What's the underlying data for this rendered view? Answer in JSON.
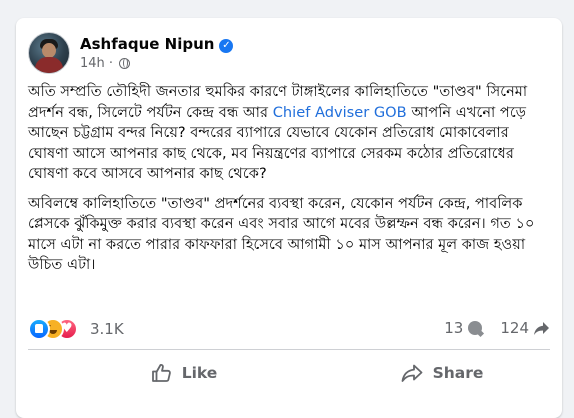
{
  "post": {
    "author": "Ashfaque Nipun",
    "verified_icon": "verified-badge-icon",
    "time": "14h",
    "separator": "·",
    "audience_icon": "globe-icon"
  },
  "content": {
    "p1_before_link": "অতি সম্প্রতি তৌহিদী জনতার হুমকির কারণে টাঙ্গাইলের কালিহাতিতে \"তাণ্ডব\" সিনেমা প্রদর্শন বন্ধ, সিলেটে পর্যটন কেন্দ্র বন্ধ আর ",
    "p1_link": "Chief Adviser GOB",
    "p1_after_link": " আপনি এখনো পড়ে আছেন চট্টগ্রাম বন্দর নিয়ে? বন্দরের ব্যাপারে যেভাবে যেকোন প্রতিরোধ মোকাবেলার ঘোষণা আসে আপনার কাছ থেকে, মব নিয়ন্ত্রণের ব্যাপারে সেরকম কঠোর প্রতিরোধের ঘোষণা কবে আসবে আপনার কাছ থেকে?",
    "p2": "অবিলম্বে কালিহাতিতে \"তাণ্ডব\" প্রদর্শনের ব্যবস্থা করেন, যেকোন পর্যটন কেন্দ্র, পাবলিক প্লেসকে ঝুঁকিমুক্ত করার ব্যবস্থা করেন এবং সবার আগে মবের উল্লম্ফন বন্ধ করেন। গত ১০ মাসে এটা না করতে পারার কাফফারা হিসেবে আগামী ১০ মাস আপনার মূল কাজ হওয়া উচিত এটা।"
  },
  "stats": {
    "reaction_icons": [
      "like-reaction-icon",
      "haha-reaction-icon",
      "love-reaction-icon"
    ],
    "reaction_count": "3.1K",
    "comment_count": "13",
    "share_count": "124"
  },
  "actions": {
    "like_label": "Like",
    "share_label": "Share"
  },
  "colors": {
    "background": "#f0f2f5",
    "link": "#216fdb",
    "muted": "#65676b",
    "verified": "#1877f2"
  }
}
